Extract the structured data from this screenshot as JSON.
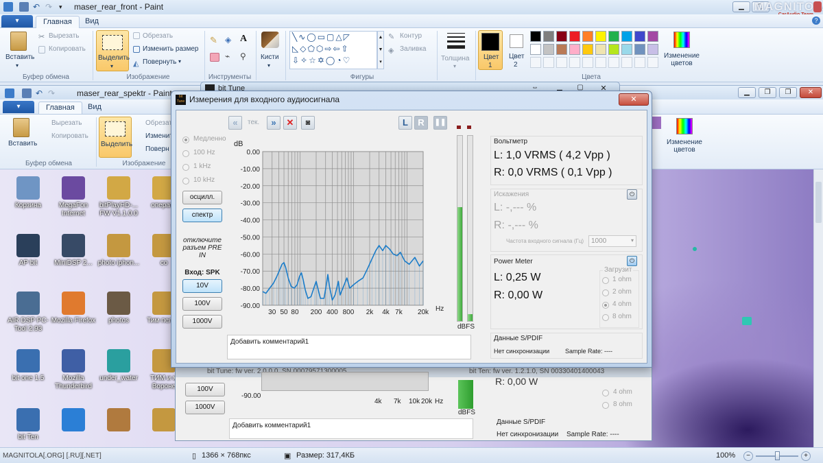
{
  "window1": {
    "title": "maser_rear_front - Paint",
    "file_menu": "▾",
    "tabs": [
      "Главная",
      "Вид"
    ],
    "clipboard": {
      "paste": "Вставить",
      "cut": "Вырезать",
      "copy": "Копировать",
      "group": "Буфер обмена"
    },
    "image": {
      "select": "Выделить",
      "crop": "Обрезать",
      "resize": "Изменить размер",
      "rotate": "Повернуть",
      "group": "Изображение"
    },
    "tools": {
      "group": "Инструменты",
      "text_tool": "A"
    },
    "brushes": {
      "label": "Кисти"
    },
    "shapes": {
      "group": "Фигуры",
      "outline": "Контур",
      "fill": "Заливка"
    },
    "thickness": {
      "label": "Толщина"
    },
    "color1": {
      "label": "Цвет",
      "num": "1"
    },
    "color2": {
      "label": "Цвет",
      "num": "2"
    },
    "colors_group": "Цвета",
    "edit_colors": "Изменение цветов",
    "palette": [
      "#000000",
      "#7f7f7f",
      "#880015",
      "#ed1c24",
      "#ff7f27",
      "#fff200",
      "#22b14c",
      "#00a2e8",
      "#3f48cc",
      "#a349a4",
      "#ffffff",
      "#c3c3c3",
      "#b97a57",
      "#ffaec9",
      "#ffc90e",
      "#efe4b0",
      "#b5e61d",
      "#99d9ea",
      "#7092be",
      "#c8bfe7"
    ]
  },
  "watermark": {
    "brand": "MAGNITOLA",
    "sub": "CarAudio Team"
  },
  "window2": {
    "title": "maser_rear_spektr - Paint",
    "tabs": [
      "Главная",
      "Вид"
    ],
    "clipboard": {
      "paste": "Вставить",
      "cut": "Вырезать",
      "copy": "Копировать",
      "group": "Буфер обмена"
    },
    "image": {
      "select": "Выделить",
      "crop": "Обрезать",
      "resize": "Изменить",
      "rotate": "Поверн",
      "group": "Изображение"
    },
    "edit_colors": "Изменение цветов"
  },
  "desktop_icons": [
    {
      "label": "Корзина"
    },
    {
      "label": "MegaFon Internet"
    },
    {
      "label": "bitPlayHD-... FW V1.1.0.0"
    },
    {
      "label": "операти"
    },
    {
      "label": "AP bit"
    },
    {
      "label": "MiniDSP 2..."
    },
    {
      "label": "photo iphon..."
    },
    {
      "label": "co"
    },
    {
      "label": "AIR DSP PC-Tool 2.93"
    },
    {
      "label": "Mozilla Firefox"
    },
    {
      "label": "photos"
    },
    {
      "label": "Тим пельм"
    },
    {
      "label": "bit one 1.5"
    },
    {
      "label": "Mozilla Thunderbird"
    },
    {
      "label": "under_water"
    },
    {
      "label": "ТИМ и м Вороне"
    },
    {
      "label": "bit Ten"
    },
    {
      "label": ""
    },
    {
      "label": ""
    },
    {
      "label": ""
    }
  ],
  "bt_under": {
    "title": "bit Tune",
    "status_left": "bit Tune: fw ver. 2.0.0.0, SN 00079571300005",
    "status_right": "bit Ten: fw ver. 1.2.1.0, SN 00330401400043",
    "btn_100": "100V",
    "btn_1000": "1000V",
    "y_tick": "-90.00",
    "x_ticks": [
      "4k",
      "7k",
      "10k",
      "20k"
    ],
    "hz": "Hz",
    "dbfs": "dBFS",
    "comment": "Добавить комментарий1",
    "ohm4": "4 ohm",
    "ohm8": "8 ohm",
    "spdif_title": "Данные S/PDIF",
    "spdif_text": "Нет синхронизации",
    "sample_rate": "Sample Rate: ----",
    "r_val": "R: 0,00 W"
  },
  "dialog": {
    "title": "Измерения для входного аудиосигнала",
    "logo": "bit Tune",
    "rate_options": [
      "Медленно",
      "100 Hz",
      "1 kHz",
      "10 kHz"
    ],
    "osc_button": "осцилл.",
    "spectrum_button": "спектр",
    "warning": "отключите разъем PRE IN",
    "input_label": "Вход: SPK",
    "input_buttons": [
      "10V",
      "100V",
      "1000V"
    ],
    "toolbar": {
      "tek": "тек.",
      "L": "L",
      "R": "R"
    },
    "comment": "Добавить комментарий1",
    "dbfs": "dBFS",
    "voltmeter": {
      "title": "Вольтметр",
      "L": "L: 1,0 VRMS ( 4,2 Vpp )",
      "R": "R: 0,0 VRMS ( 0,1 Vpp )"
    },
    "distortion": {
      "title": "Искажения",
      "L": "L: -,--- %",
      "R": "R: -,--- %",
      "freq_label": "Частота входного сигнала (Гц)",
      "freq_value": "1000"
    },
    "power": {
      "title": "Power Meter",
      "L": "L: 0,25 W",
      "R": "R: 0,00 W",
      "load_title": "Загрузит",
      "loads": [
        "1 ohm",
        "2 ohm",
        "4 ohm",
        "8 ohm"
      ],
      "selected_load": "4 ohm"
    },
    "spdif": {
      "title": "Данные S/PDIF",
      "status": "Нет синхронизации",
      "sample_rate": "Sample Rate: ----"
    }
  },
  "statusbar": {
    "left": "MAGNITOLA[.ORG] [.RU][.NET]",
    "dims": "1366 × 768пкс",
    "size": "Размер: 317,4КБ",
    "zoom": "100%"
  },
  "chart_data": {
    "type": "line",
    "ylabel": "dB",
    "xlabel": "Hz",
    "y_ticks": [
      "0.00",
      "-10.00",
      "-20.00",
      "-30.00",
      "-40.00",
      "-50.00",
      "-60.00",
      "-70.00",
      "-80.00",
      "-90.00"
    ],
    "ylim": [
      -90,
      0
    ],
    "x_scale": "log",
    "xlim": [
      20,
      20000
    ],
    "x_ticks": [
      {
        "v": 30,
        "label": "30"
      },
      {
        "v": 50,
        "label": "50"
      },
      {
        "v": 80,
        "label": "80"
      },
      {
        "v": 200,
        "label": "200"
      },
      {
        "v": 400,
        "label": "400"
      },
      {
        "v": 800,
        "label": "800"
      },
      {
        "v": 2000,
        "label": "2k"
      },
      {
        "v": 4000,
        "label": "4k"
      },
      {
        "v": 7000,
        "label": "7k"
      },
      {
        "v": 20000,
        "label": "20k"
      }
    ],
    "series": [
      {
        "color": "#1a7cc9",
        "points": [
          [
            20,
            -82
          ],
          [
            23,
            -83
          ],
          [
            27,
            -80
          ],
          [
            32,
            -77
          ],
          [
            37,
            -73
          ],
          [
            42,
            -69
          ],
          [
            46,
            -66
          ],
          [
            50,
            -65
          ],
          [
            54,
            -68
          ],
          [
            60,
            -74
          ],
          [
            68,
            -79
          ],
          [
            78,
            -80
          ],
          [
            88,
            -78
          ],
          [
            98,
            -73
          ],
          [
            106,
            -71
          ],
          [
            114,
            -75
          ],
          [
            125,
            -81
          ],
          [
            140,
            -86
          ],
          [
            160,
            -85
          ],
          [
            185,
            -79
          ],
          [
            200,
            -76
          ],
          [
            215,
            -80
          ],
          [
            240,
            -86
          ],
          [
            280,
            -86
          ],
          [
            310,
            -78
          ],
          [
            330,
            -72
          ],
          [
            355,
            -79
          ],
          [
            400,
            -87
          ],
          [
            450,
            -84
          ],
          [
            520,
            -76
          ],
          [
            560,
            -84
          ],
          [
            650,
            -79
          ],
          [
            750,
            -74
          ],
          [
            850,
            -80
          ],
          [
            1000,
            -78
          ],
          [
            1200,
            -76
          ],
          [
            1500,
            -74
          ],
          [
            1800,
            -69
          ],
          [
            2200,
            -63
          ],
          [
            2600,
            -58
          ],
          [
            3000,
            -55
          ],
          [
            3500,
            -58
          ],
          [
            4000,
            -55
          ],
          [
            4700,
            -57
          ],
          [
            5500,
            -60
          ],
          [
            6500,
            -61
          ],
          [
            7500,
            -59
          ],
          [
            9000,
            -64
          ],
          [
            11000,
            -66
          ],
          [
            14000,
            -62
          ],
          [
            17000,
            -67
          ],
          [
            20000,
            -64
          ]
        ]
      }
    ]
  }
}
